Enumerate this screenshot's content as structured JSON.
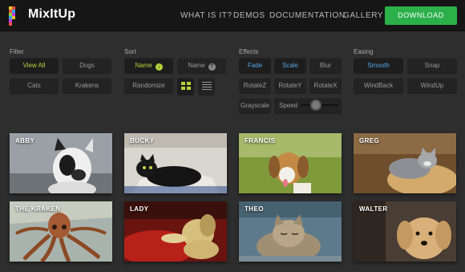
{
  "brand": {
    "name": "MixItUp"
  },
  "nav": {
    "items": [
      "WHAT IS IT?",
      "DEMOS",
      "DOCUMENTATION",
      "GALLERY"
    ],
    "download": "DOWNLOAD"
  },
  "filter": {
    "label": "Filter",
    "options": [
      "View All",
      "Dogs",
      "Cats",
      "Krakens"
    ],
    "active": "View All"
  },
  "sort": {
    "label": "Sort",
    "name_asc": "Name",
    "name_asc_icon": "arrow-down-circle-icon",
    "name_desc": "Name",
    "name_desc_icon": "question-circle-icon",
    "randomize": "Randomize",
    "views": [
      "grid-view-icon",
      "list-view-icon"
    ]
  },
  "effects": {
    "label": "Effects",
    "options": [
      "Fade",
      "Scale",
      "Blur",
      "RotateZ",
      "RotateY",
      "RotateX",
      "Grayscale"
    ],
    "active": [
      "Fade",
      "Scale"
    ],
    "speed_label": "Speed",
    "speed_level": 0.4
  },
  "easing": {
    "label": "Easing",
    "options": [
      "Smooth",
      "Snap",
      "WindBack",
      "WindUp"
    ],
    "active": "Smooth"
  },
  "gallery": [
    {
      "name": "ABBY"
    },
    {
      "name": "BUCKY"
    },
    {
      "name": "FRANCIS"
    },
    {
      "name": "GREG"
    },
    {
      "name": "THE KRAKEN"
    },
    {
      "name": "LADY"
    },
    {
      "name": "THEO"
    },
    {
      "name": "WALTER"
    }
  ],
  "colors": {
    "accent_green": "#b7d23a",
    "accent_blue": "#55a6e8",
    "download_green": "#2bb04a"
  }
}
